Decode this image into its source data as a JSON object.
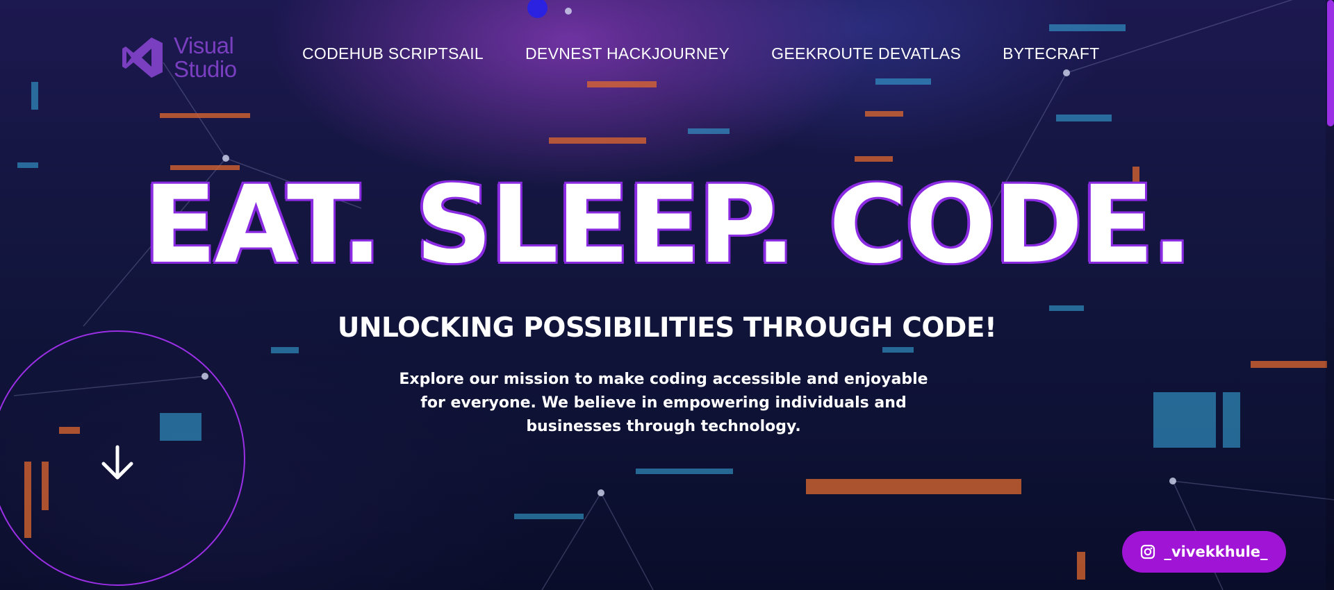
{
  "logo": {
    "line1": "Visual",
    "line2": "Studio"
  },
  "nav": [
    {
      "label": "CODEHUB SCRIPTSAIL"
    },
    {
      "label": "DEVNEST HACKJOURNEY"
    },
    {
      "label": "GEEKROUTE DEVATLAS"
    },
    {
      "label": "BYTECRAFT"
    }
  ],
  "hero": {
    "title": "EAT. SLEEP. CODE.",
    "subtitle": "UNLOCKING POSSIBILITIES THROUGH CODE!",
    "description": "Explore our mission to make coding accessible and enjoyable for everyone. We believe in empowering individuals and businesses through technology."
  },
  "scroll_indicator": {
    "icon": "arrow-down-icon"
  },
  "social": {
    "icon": "instagram-icon",
    "handle": "_vivekkhule_"
  },
  "colors": {
    "accent": "#9b2fe6",
    "brand": "#7a3fc0",
    "button": "#a014d6",
    "dot": "#2a22e0"
  }
}
